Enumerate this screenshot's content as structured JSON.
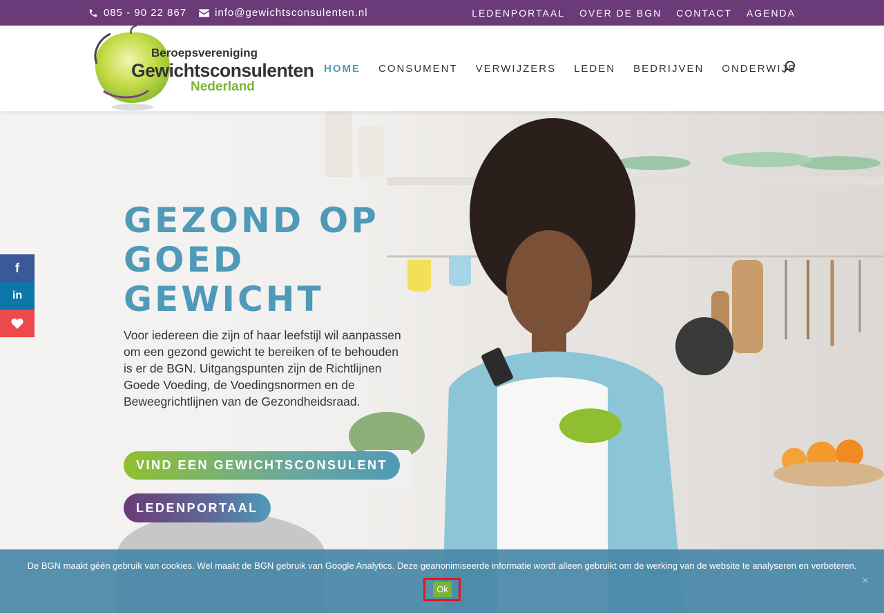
{
  "topbar": {
    "phone": "085 - 90 22 867",
    "email": "info@gewichtsconsulenten.nl",
    "links": [
      "LEDENPORTAAL",
      "OVER DE BGN",
      "CONTACT",
      "AGENDA"
    ]
  },
  "logo": {
    "line1": "Beroepsvereniging",
    "line2": "Gewichtsconsulenten",
    "line3": "Nederland"
  },
  "nav": {
    "items": [
      "HOME",
      "CONSUMENT",
      "VERWIJZERS",
      "LEDEN",
      "BEDRIJVEN",
      "ONDERWIJS"
    ],
    "active_index": 0
  },
  "hero": {
    "title_line1": "GEZOND OP",
    "title_line2": "GOED",
    "title_line3": "GEWICHT",
    "text": "Voor iedereen die zijn of haar leefstijl wil aanpassen om een gezond gewicht te bereiken of te behouden is er de BGN. Uitgangspunten zijn de Richtlijnen Goede Voeding, de Voedingsnormen en de Beweegrichtlijnen van de Gezondheidsraad.",
    "button_find": "VIND EEN GEWICHTSCONSULENT",
    "button_portal": "LEDENPORTAAL"
  },
  "share": {
    "facebook": "f",
    "linkedin": "in"
  },
  "cookie": {
    "text": "De BGN maakt géén gebruik van cookies. Wel maakt de BGN gebruik van Google Analytics. Deze geanonimiseerde informatie wordt alleen gebruikt om de werking van de website te analyseren en verbeteren.",
    "ok_label": "Ok",
    "close_label": "×"
  },
  "colors": {
    "purple": "#6b3a78",
    "teal": "#4f9ab8",
    "green": "#8fbf2f",
    "cookie_bg": "#4888a8"
  }
}
